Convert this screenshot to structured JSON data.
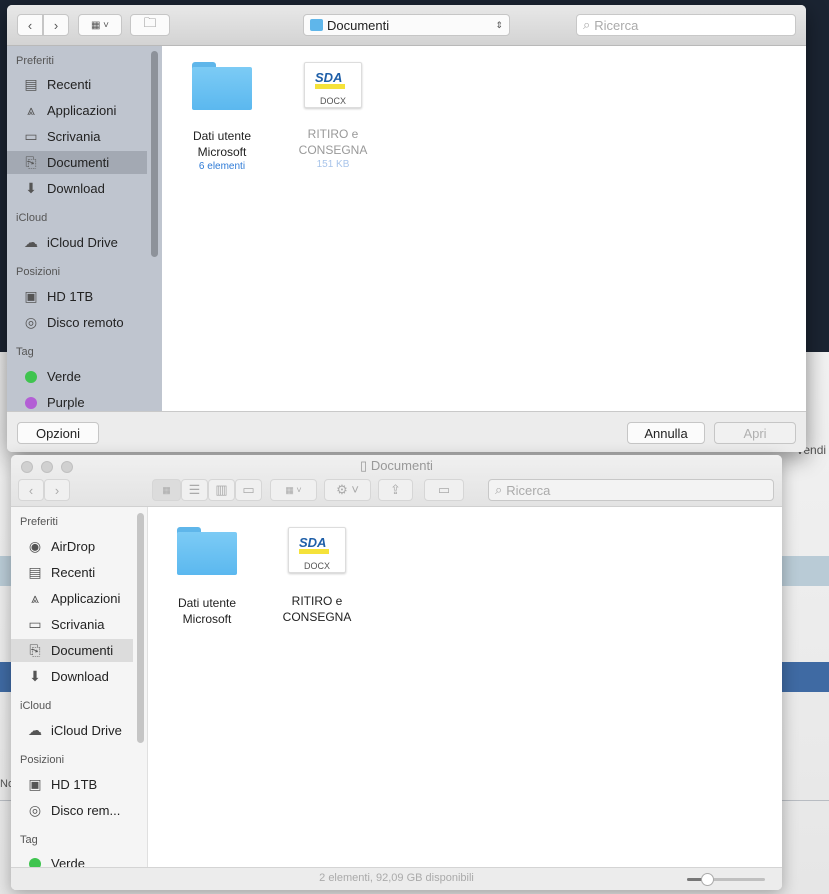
{
  "background": {
    "partial_text": "Vendi",
    "partial_text2": "No"
  },
  "dialog": {
    "path_popup": "Documenti",
    "search_placeholder": "Ricerca",
    "sidebar": {
      "sections": [
        {
          "label": "Preferiti",
          "items": [
            {
              "label": "Recenti",
              "icon": "recents-icon"
            },
            {
              "label": "Applicazioni",
              "icon": "applications-icon"
            },
            {
              "label": "Scrivania",
              "icon": "desktop-icon"
            },
            {
              "label": "Documenti",
              "icon": "documents-icon",
              "selected": true
            },
            {
              "label": "Download",
              "icon": "download-icon"
            }
          ]
        },
        {
          "label": "iCloud",
          "items": [
            {
              "label": "iCloud Drive",
              "icon": "cloud-icon"
            }
          ]
        },
        {
          "label": "Posizioni",
          "items": [
            {
              "label": "HD 1TB",
              "icon": "hard-drive-icon"
            },
            {
              "label": "Disco remoto",
              "icon": "disc-icon"
            }
          ]
        },
        {
          "label": "Tag",
          "items": [
            {
              "label": "Verde",
              "color": "#3fc44f"
            },
            {
              "label": "Purple",
              "color": "#b35fd5"
            }
          ]
        }
      ]
    },
    "files": [
      {
        "name_line1": "Dati utente",
        "name_line2": "Microsoft",
        "info": "6 elementi",
        "type": "folder"
      },
      {
        "name_line1": "RITIRO e",
        "name_line2": "CONSEGNA",
        "info": "151 KB",
        "type": "docx",
        "thumb_brand": "SDA",
        "thumb_ext": "DOCX"
      }
    ],
    "options_button": "Opzioni",
    "cancel_button": "Annulla",
    "open_button": "Apri"
  },
  "finder": {
    "title": "Documenti",
    "search_placeholder": "Ricerca",
    "sidebar": {
      "sections": [
        {
          "label": "Preferiti",
          "items": [
            {
              "label": "AirDrop",
              "icon": "airdrop-icon"
            },
            {
              "label": "Recenti",
              "icon": "recents-icon"
            },
            {
              "label": "Applicazioni",
              "icon": "applications-icon"
            },
            {
              "label": "Scrivania",
              "icon": "desktop-icon"
            },
            {
              "label": "Documenti",
              "icon": "documents-icon",
              "selected": true
            },
            {
              "label": "Download",
              "icon": "download-icon"
            }
          ]
        },
        {
          "label": "iCloud",
          "items": [
            {
              "label": "iCloud Drive",
              "icon": "cloud-icon"
            }
          ]
        },
        {
          "label": "Posizioni",
          "items": [
            {
              "label": "HD 1TB",
              "icon": "hard-drive-icon"
            },
            {
              "label": "Disco rem...",
              "icon": "disc-icon"
            }
          ]
        },
        {
          "label": "Tag",
          "items": [
            {
              "label": "Verde",
              "color": "#3fc44f"
            }
          ]
        }
      ]
    },
    "files": [
      {
        "name_line1": "Dati utente",
        "name_line2": "Microsoft",
        "type": "folder"
      },
      {
        "name_line1": "RITIRO e",
        "name_line2": "CONSEGNA",
        "type": "docx",
        "thumb_brand": "SDA",
        "thumb_ext": "DOCX"
      }
    ],
    "status": "2 elementi, 92,09 GB disponibili",
    "icon_size_slider": 0.25
  }
}
